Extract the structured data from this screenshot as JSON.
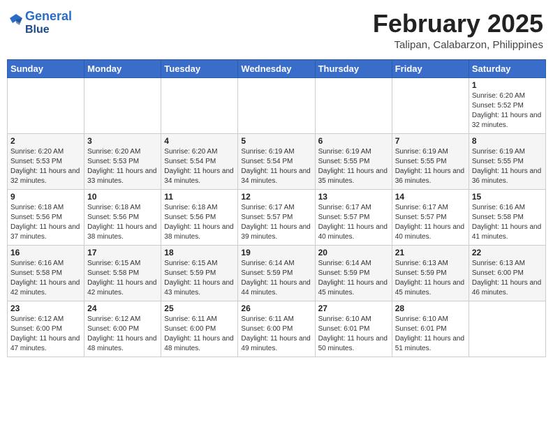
{
  "header": {
    "logo_line1": "General",
    "logo_line2": "Blue",
    "month": "February 2025",
    "location": "Talipan, Calabarzon, Philippines"
  },
  "weekdays": [
    "Sunday",
    "Monday",
    "Tuesday",
    "Wednesday",
    "Thursday",
    "Friday",
    "Saturday"
  ],
  "weeks": [
    [
      {
        "day": "",
        "info": ""
      },
      {
        "day": "",
        "info": ""
      },
      {
        "day": "",
        "info": ""
      },
      {
        "day": "",
        "info": ""
      },
      {
        "day": "",
        "info": ""
      },
      {
        "day": "",
        "info": ""
      },
      {
        "day": "1",
        "info": "Sunrise: 6:20 AM\nSunset: 5:52 PM\nDaylight: 11 hours and 32 minutes."
      }
    ],
    [
      {
        "day": "2",
        "info": "Sunrise: 6:20 AM\nSunset: 5:53 PM\nDaylight: 11 hours and 32 minutes."
      },
      {
        "day": "3",
        "info": "Sunrise: 6:20 AM\nSunset: 5:53 PM\nDaylight: 11 hours and 33 minutes."
      },
      {
        "day": "4",
        "info": "Sunrise: 6:20 AM\nSunset: 5:54 PM\nDaylight: 11 hours and 34 minutes."
      },
      {
        "day": "5",
        "info": "Sunrise: 6:19 AM\nSunset: 5:54 PM\nDaylight: 11 hours and 34 minutes."
      },
      {
        "day": "6",
        "info": "Sunrise: 6:19 AM\nSunset: 5:55 PM\nDaylight: 11 hours and 35 minutes."
      },
      {
        "day": "7",
        "info": "Sunrise: 6:19 AM\nSunset: 5:55 PM\nDaylight: 11 hours and 36 minutes."
      },
      {
        "day": "8",
        "info": "Sunrise: 6:19 AM\nSunset: 5:55 PM\nDaylight: 11 hours and 36 minutes."
      }
    ],
    [
      {
        "day": "9",
        "info": "Sunrise: 6:18 AM\nSunset: 5:56 PM\nDaylight: 11 hours and 37 minutes."
      },
      {
        "day": "10",
        "info": "Sunrise: 6:18 AM\nSunset: 5:56 PM\nDaylight: 11 hours and 38 minutes."
      },
      {
        "day": "11",
        "info": "Sunrise: 6:18 AM\nSunset: 5:56 PM\nDaylight: 11 hours and 38 minutes."
      },
      {
        "day": "12",
        "info": "Sunrise: 6:17 AM\nSunset: 5:57 PM\nDaylight: 11 hours and 39 minutes."
      },
      {
        "day": "13",
        "info": "Sunrise: 6:17 AM\nSunset: 5:57 PM\nDaylight: 11 hours and 40 minutes."
      },
      {
        "day": "14",
        "info": "Sunrise: 6:17 AM\nSunset: 5:57 PM\nDaylight: 11 hours and 40 minutes."
      },
      {
        "day": "15",
        "info": "Sunrise: 6:16 AM\nSunset: 5:58 PM\nDaylight: 11 hours and 41 minutes."
      }
    ],
    [
      {
        "day": "16",
        "info": "Sunrise: 6:16 AM\nSunset: 5:58 PM\nDaylight: 11 hours and 42 minutes."
      },
      {
        "day": "17",
        "info": "Sunrise: 6:15 AM\nSunset: 5:58 PM\nDaylight: 11 hours and 42 minutes."
      },
      {
        "day": "18",
        "info": "Sunrise: 6:15 AM\nSunset: 5:59 PM\nDaylight: 11 hours and 43 minutes."
      },
      {
        "day": "19",
        "info": "Sunrise: 6:14 AM\nSunset: 5:59 PM\nDaylight: 11 hours and 44 minutes."
      },
      {
        "day": "20",
        "info": "Sunrise: 6:14 AM\nSunset: 5:59 PM\nDaylight: 11 hours and 45 minutes."
      },
      {
        "day": "21",
        "info": "Sunrise: 6:13 AM\nSunset: 5:59 PM\nDaylight: 11 hours and 45 minutes."
      },
      {
        "day": "22",
        "info": "Sunrise: 6:13 AM\nSunset: 6:00 PM\nDaylight: 11 hours and 46 minutes."
      }
    ],
    [
      {
        "day": "23",
        "info": "Sunrise: 6:12 AM\nSunset: 6:00 PM\nDaylight: 11 hours and 47 minutes."
      },
      {
        "day": "24",
        "info": "Sunrise: 6:12 AM\nSunset: 6:00 PM\nDaylight: 11 hours and 48 minutes."
      },
      {
        "day": "25",
        "info": "Sunrise: 6:11 AM\nSunset: 6:00 PM\nDaylight: 11 hours and 48 minutes."
      },
      {
        "day": "26",
        "info": "Sunrise: 6:11 AM\nSunset: 6:00 PM\nDaylight: 11 hours and 49 minutes."
      },
      {
        "day": "27",
        "info": "Sunrise: 6:10 AM\nSunset: 6:01 PM\nDaylight: 11 hours and 50 minutes."
      },
      {
        "day": "28",
        "info": "Sunrise: 6:10 AM\nSunset: 6:01 PM\nDaylight: 11 hours and 51 minutes."
      },
      {
        "day": "",
        "info": ""
      }
    ]
  ]
}
